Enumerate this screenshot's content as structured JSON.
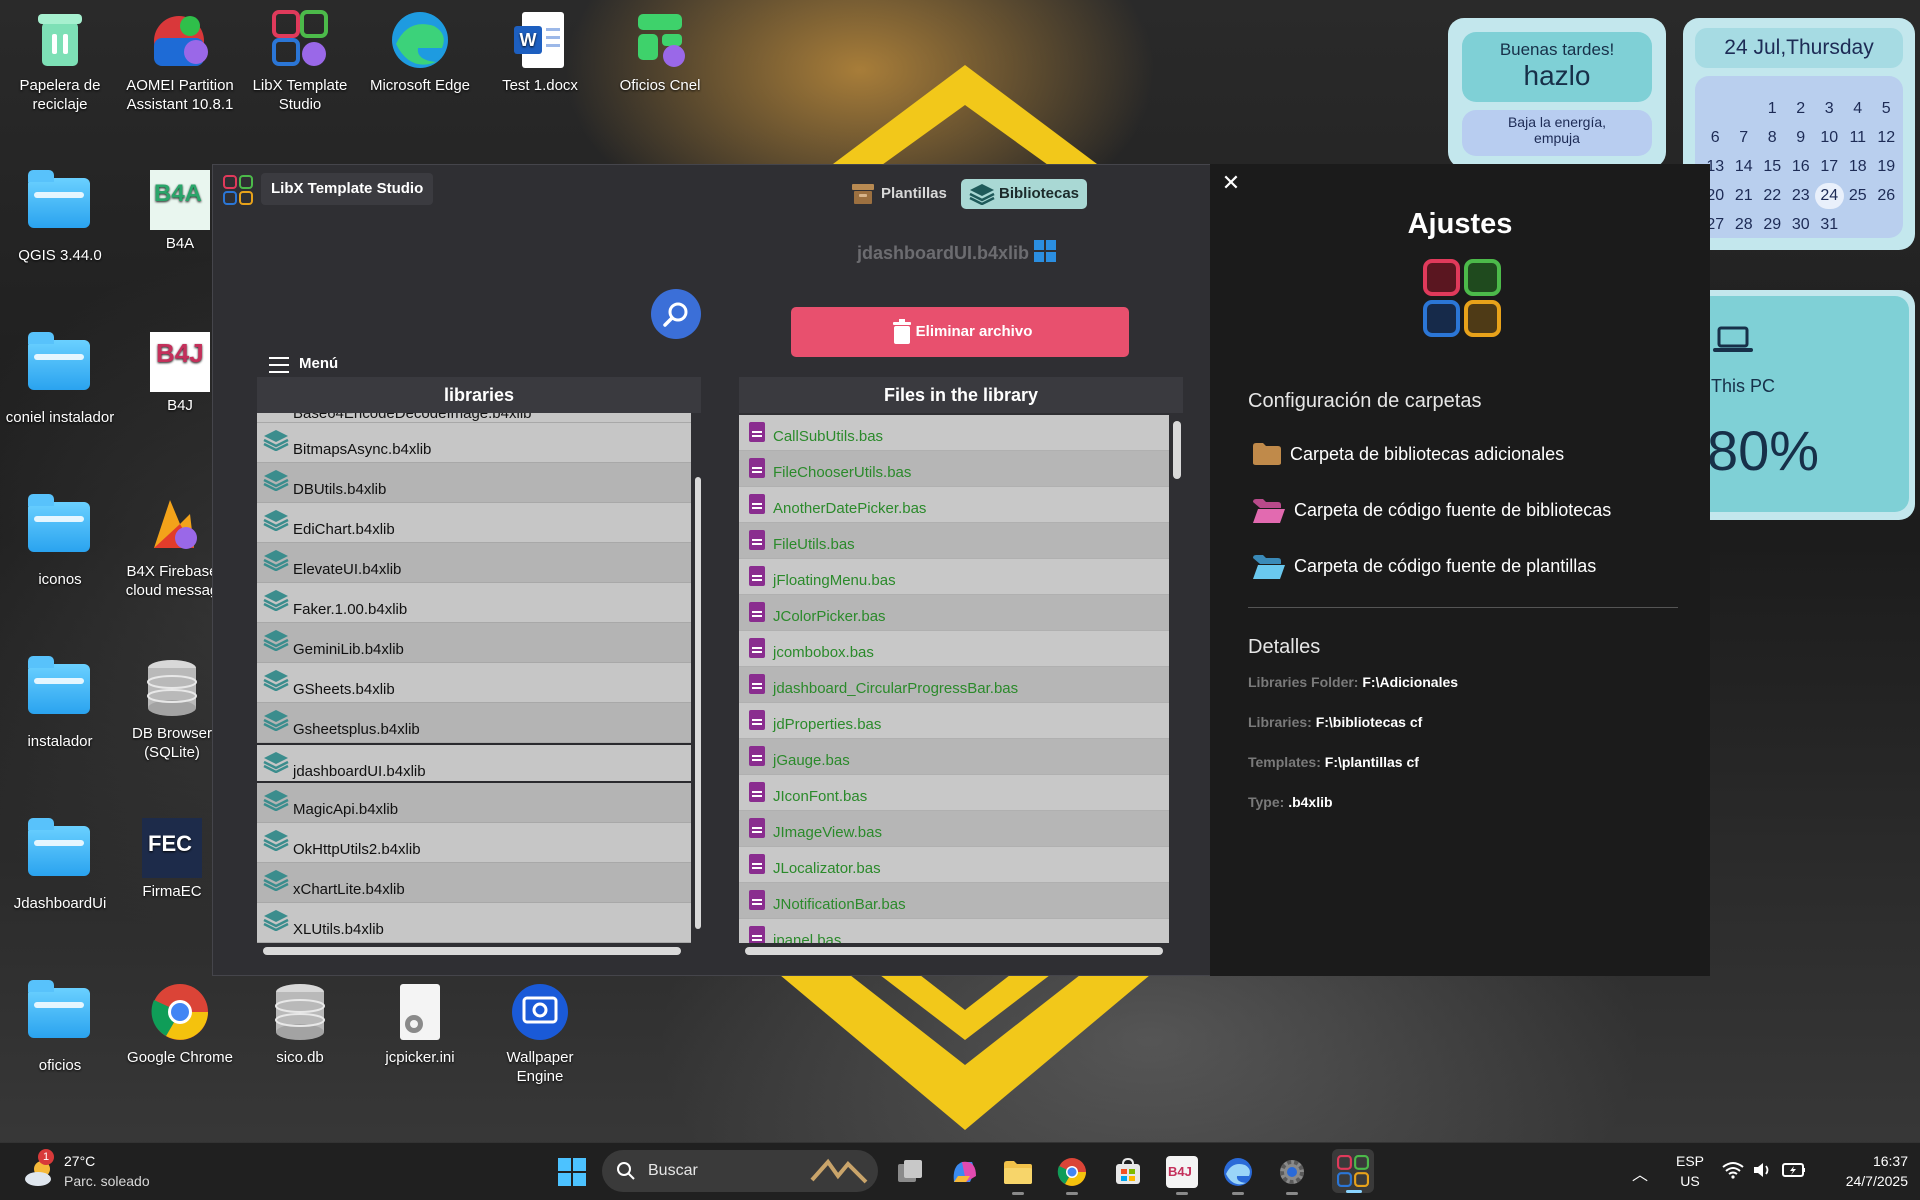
{
  "desktop_icons": [
    {
      "label": "Papelera de reciclaje",
      "icon": "recycle-bin-icon"
    },
    {
      "label": "AOMEI Partition Assistant 10.8.1",
      "icon": "aomei-icon"
    },
    {
      "label": "LibX Template Studio",
      "icon": "libx-icon"
    },
    {
      "label": "Microsoft Edge",
      "icon": "edge-icon"
    },
    {
      "label": "Test 1.docx",
      "icon": "word-icon"
    },
    {
      "label": "Oficios Cnel",
      "icon": "oficios-app-icon"
    },
    {
      "label": "QGIS 3.44.0",
      "icon": "folder-icon"
    },
    {
      "label": "B4A",
      "icon": "b4a-icon"
    },
    {
      "label": "coniel instalador",
      "icon": "folder-icon"
    },
    {
      "label": "B4J",
      "icon": "b4j-icon"
    },
    {
      "label": "iconos",
      "icon": "folder-icon"
    },
    {
      "label": "B4X Firebase cloud messag",
      "icon": "firebase-icon"
    },
    {
      "label": "instalador",
      "icon": "folder-icon"
    },
    {
      "label": "DB Browser (SQLite)",
      "icon": "database-icon"
    },
    {
      "label": "JdashboardUi",
      "icon": "folder-icon"
    },
    {
      "label": "FirmaEC",
      "icon": "firmaec-icon"
    },
    {
      "label": "oficios",
      "icon": "folder-icon"
    },
    {
      "label": "Google Chrome",
      "icon": "chrome-icon"
    },
    {
      "label": "sico.db",
      "icon": "database-icon"
    },
    {
      "label": "jcpicker.ini",
      "icon": "ini-file-icon"
    },
    {
      "label": "Wallpaper Engine",
      "icon": "wallpaper-engine-icon"
    }
  ],
  "widgets": {
    "greeting": {
      "line1": "Buenas tardes!",
      "line2": "hazlo",
      "line3": "Baja la energía, empuja"
    },
    "calendar": {
      "header": "24 Jul,Thursday",
      "days": [
        "",
        "",
        "1",
        "2",
        "3",
        "4",
        "5",
        "6",
        "7",
        "8",
        "9",
        "10",
        "11",
        "12",
        "13",
        "14",
        "15",
        "16",
        "17",
        "18",
        "19",
        "20",
        "21",
        "22",
        "23",
        "24",
        "25",
        "26",
        "27",
        "28",
        "29",
        "30",
        "31"
      ],
      "today": "24"
    },
    "pc": {
      "label": "This PC",
      "value": "80%"
    }
  },
  "app": {
    "title": "LibX Template Studio",
    "tabs": {
      "templates": "Plantillas",
      "libraries": "Bibliotecas"
    },
    "selected_file": "jdashboardUI.b4xlib",
    "delete_button": "Eliminar archivo",
    "menu_label": "Menú",
    "libraries_header": "libraries",
    "files_header": "Files in the library",
    "libraries_cut_top": "Base64EncodeDecodeImage.b4xlib",
    "libraries": [
      "BitmapsAsync.b4xlib",
      "DBUtils.b4xlib",
      "EdiChart.b4xlib",
      "ElevateUI.b4xlib",
      "Faker.1.00.b4xlib",
      "GeminiLib.b4xlib",
      "GSheets.b4xlib",
      "Gsheetsplus.b4xlib",
      "jdashboardUI.b4xlib",
      "MagicApi.b4xlib",
      "OkHttpUtils2.b4xlib",
      "xChartLite.b4xlib",
      "XLUtils.b4xlib"
    ],
    "selected_library": "jdashboardUI.b4xlib",
    "files": [
      "CallSubUtils.bas",
      "FileChooserUtils.bas",
      "AnotherDatePicker.bas",
      "FileUtils.bas",
      "jFloatingMenu.bas",
      "JColorPicker.bas",
      "jcombobox.bas",
      "jdashboard_CircularProgressBar.bas",
      "jdProperties.bas",
      "jGauge.bas",
      "JIconFont.bas",
      "JImageView.bas",
      "JLocalizator.bas",
      "JNotificationBar.bas",
      "jpanel.bas"
    ]
  },
  "settings": {
    "title": "Ajustes",
    "folders_header": "Configuración de carpetas",
    "items": [
      "Carpeta de bibliotecas adicionales",
      "Carpeta de código fuente de bibliotecas",
      "Carpeta de código fuente de plantillas"
    ],
    "details_header": "Detalles",
    "details": [
      {
        "key": "Libraries Folder:",
        "value": "F:\\Adicionales"
      },
      {
        "key": "Libraries:",
        "value": "F:\\bibliotecas cf"
      },
      {
        "key": "Templates:",
        "value": "F:\\plantillas cf"
      },
      {
        "key": "Type:",
        "value": ".b4xlib"
      }
    ]
  },
  "taskbar": {
    "weather_temp": "27°C",
    "weather_desc": "Parc. soleado",
    "weather_badge": "1",
    "search_placeholder": "Buscar",
    "lang_top": "ESP",
    "lang_bottom": "US",
    "time": "16:37",
    "date": "24/7/2025"
  },
  "colors": {
    "accent_pink": "#e8506e",
    "tab_active": "#a9d8d4",
    "file_green": "#2b8a2b",
    "file_icon": "#8a2d8f"
  }
}
